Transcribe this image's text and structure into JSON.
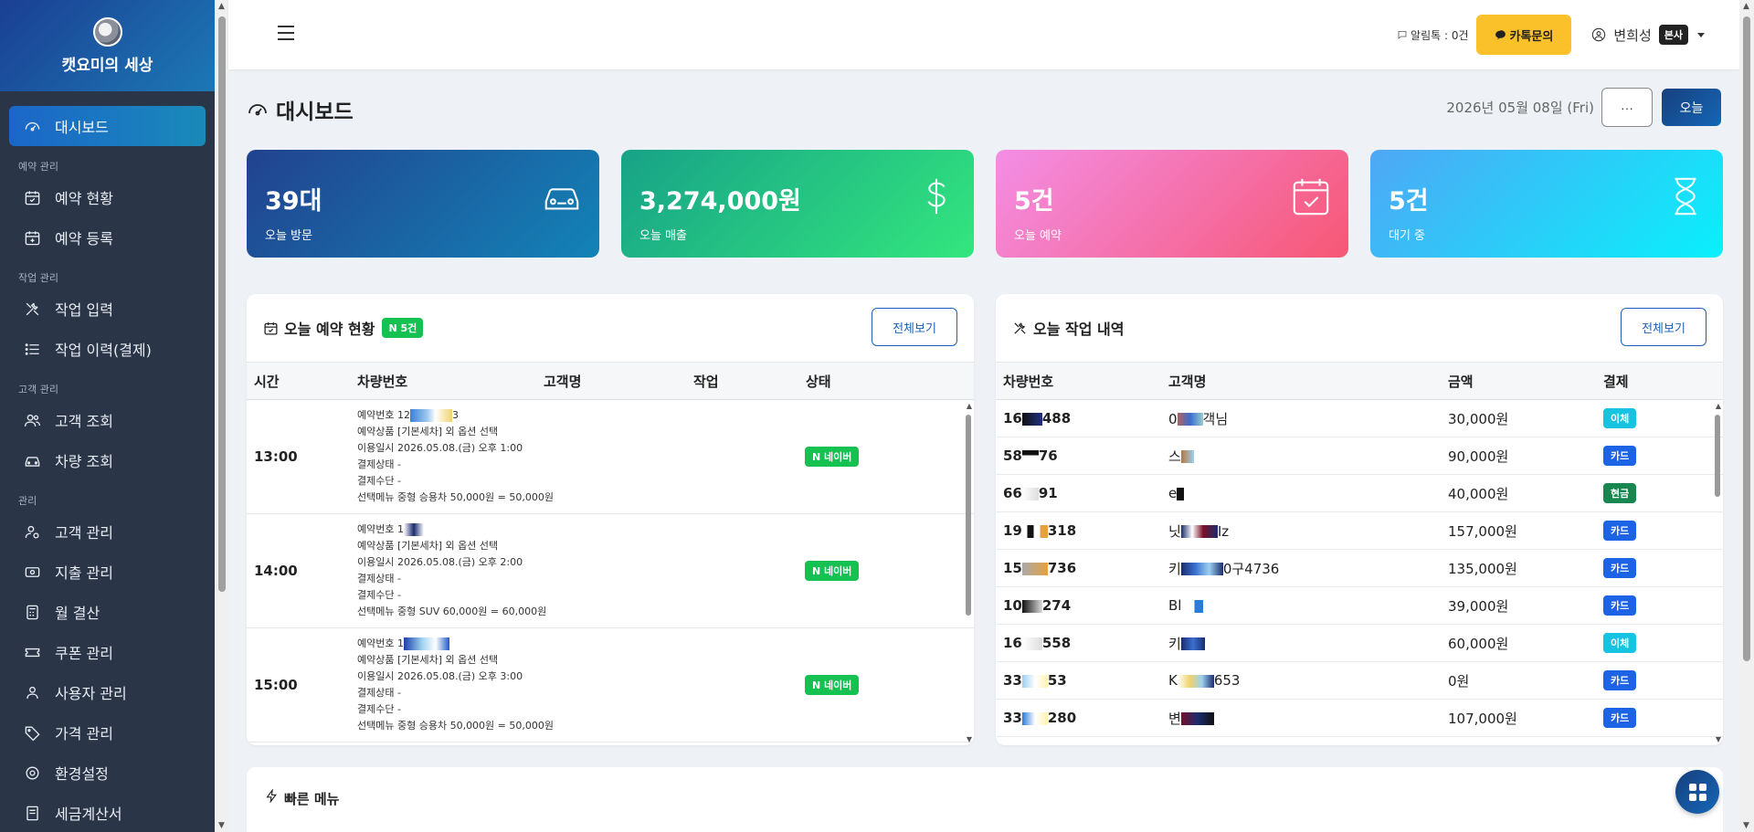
{
  "sidebar": {
    "brand": "캣요미의 세상",
    "dashboard": "대시보드",
    "sections": {
      "reservation": "예약 관리",
      "work": "작업 관리",
      "customer": "고객 관리",
      "admin": "관리"
    },
    "items": {
      "reservation_status": "예약 현황",
      "reservation_register": "예약 등록",
      "work_input": "작업 입력",
      "work_history": "작업 이력(결제)",
      "customer_lookup": "고객 조회",
      "vehicle_lookup": "차량 조회",
      "customer_manage": "고객 관리",
      "expense_manage": "지출 관리",
      "monthly_settle": "월 결산",
      "coupon_manage": "쿠폰 관리",
      "user_manage": "사용자 관리",
      "price_manage": "가격 관리",
      "settings": "환경설정",
      "tax_invoice": "세금계산서"
    }
  },
  "topbar": {
    "alimtalk": "알림톡 : 0건",
    "kakao_btn": "카톡문의",
    "user_name": "변희성",
    "user_badge": "본사"
  },
  "page": {
    "title": "대시보드",
    "date": "2026년 05월 08일 (Fri)",
    "dots_btn": "···",
    "today_btn": "오늘"
  },
  "stats": [
    {
      "value": "39대",
      "label": "오늘 방문",
      "icon": "car-icon"
    },
    {
      "value": "3,274,000원",
      "label": "오늘 매출",
      "icon": "dollar-icon"
    },
    {
      "value": "5건",
      "label": "오늘 예약",
      "icon": "calendar-check-icon"
    },
    {
      "value": "5건",
      "label": "대기 중",
      "icon": "hourglass-icon"
    }
  ],
  "reservations": {
    "title": "오늘 예약 현황",
    "badge": "N 5건",
    "more": "전체보기",
    "headers": {
      "time": "시간",
      "vehicle": "차량번호",
      "customer": "고객명",
      "work": "작업",
      "status": "상태"
    },
    "rows": [
      {
        "time": "13:00",
        "res_no": "예약번호 12",
        "res_no_tail": "3",
        "product": "예약상품 [기본세차] 외 옵션 선택",
        "date": "이용일시 2026.05.08.(금) 오후 1:00",
        "pay_state": "결제상태 -",
        "pay_method": "결제수단 -",
        "menu": "선택메뉴 중형 승용차 50,000원 = 50,000원",
        "status": "N 네이버"
      },
      {
        "time": "14:00",
        "res_no": "예약번호 1",
        "res_no_tail": "",
        "product": "예약상품 [기본세차] 외 옵션 선택",
        "date": "이용일시 2026.05.08.(금) 오후 2:00",
        "pay_state": "결제상태 -",
        "pay_method": "결제수단 -",
        "menu": "선택메뉴 중형 SUV 60,000원 = 60,000원",
        "status": "N 네이버"
      },
      {
        "time": "15:00",
        "res_no": "예약번호 1",
        "res_no_tail": "",
        "product": "예약상품 [기본세차] 외 옵션 선택",
        "date": "이용일시 2026.05.08.(금) 오후 3:00",
        "pay_state": "결제상태 -",
        "pay_method": "결제수단 -",
        "menu": "선택메뉴 중형 승용차 50,000원 = 50,000원",
        "status": "N 네이버"
      }
    ]
  },
  "work": {
    "title": "오늘 작업 내역",
    "more": "전체보기",
    "headers": {
      "vehicle": "차량번호",
      "customer": "고객명",
      "amount": "금액",
      "payment": "결제"
    },
    "rows": [
      {
        "vehicle_a": "16",
        "vehicle_b": "488",
        "cust_a": "0",
        "cust_b": "객님",
        "amount": "30,000원",
        "payment": "이체",
        "pay_color": "#17c3e0"
      },
      {
        "vehicle_a": "58",
        "vehicle_b": "76",
        "cust_a": "스",
        "cust_b": "",
        "amount": "90,000원",
        "payment": "카드",
        "pay_color": "#1c64e5"
      },
      {
        "vehicle_a": "66",
        "vehicle_b": "91",
        "cust_a": "e",
        "cust_b": "",
        "amount": "40,000원",
        "payment": "현금",
        "pay_color": "#17864f"
      },
      {
        "vehicle_a": "19",
        "vehicle_b": "318",
        "cust_a": "닛",
        "cust_b": "Iz",
        "amount": "157,000원",
        "payment": "카드",
        "pay_color": "#1c64e5"
      },
      {
        "vehicle_a": "15",
        "vehicle_b": "736",
        "cust_a": "키",
        "cust_b": "0구4736",
        "amount": "135,000원",
        "payment": "카드",
        "pay_color": "#1c64e5"
      },
      {
        "vehicle_a": "10",
        "vehicle_b": "274",
        "cust_a": "Bl",
        "cust_b": "",
        "amount": "39,000원",
        "payment": "카드",
        "pay_color": "#1c64e5"
      },
      {
        "vehicle_a": "16",
        "vehicle_b": "558",
        "cust_a": "키",
        "cust_b": "",
        "amount": "60,000원",
        "payment": "이체",
        "pay_color": "#17c3e0"
      },
      {
        "vehicle_a": "33",
        "vehicle_b": "53",
        "cust_a": "K",
        "cust_b": "653",
        "amount": "0원",
        "payment": "카드",
        "pay_color": "#1c64e5"
      },
      {
        "vehicle_a": "33",
        "vehicle_b": "280",
        "cust_a": "변",
        "cust_b": "",
        "amount": "107,000원",
        "payment": "카드",
        "pay_color": "#1c64e5"
      }
    ]
  },
  "quick": {
    "title": "빠른 메뉴"
  }
}
